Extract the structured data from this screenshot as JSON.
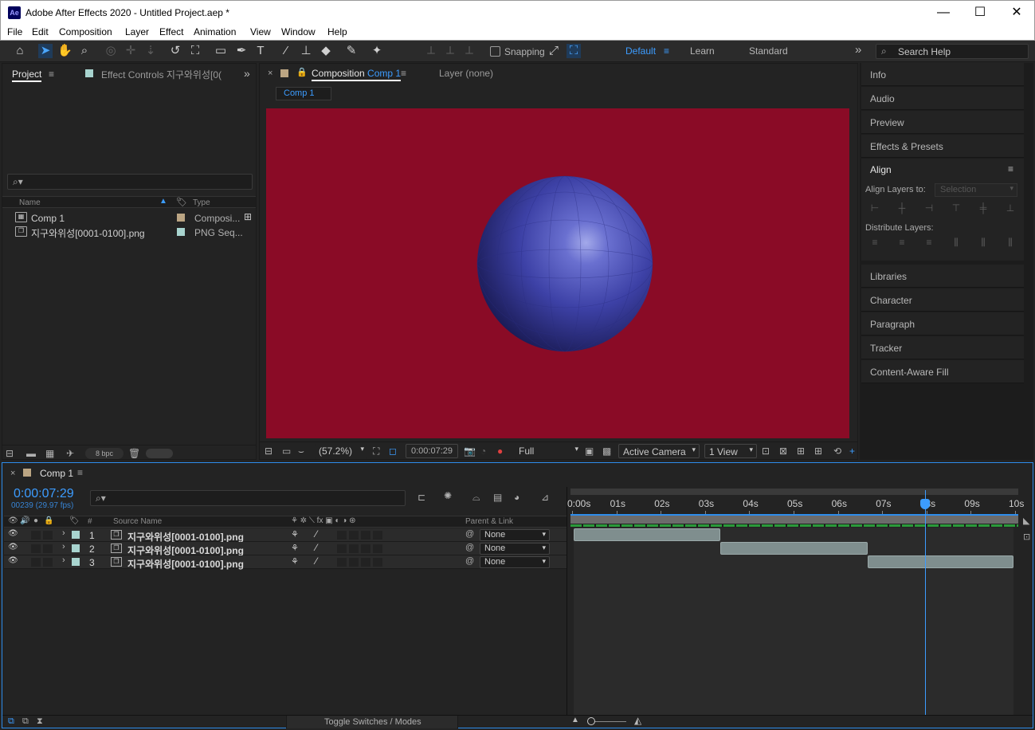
{
  "app": {
    "logo": "Ae",
    "title": "Adobe After Effects 2020 - Untitled Project.aep *",
    "minimize": "—",
    "maximize": "☐",
    "close": "✕"
  },
  "menu": [
    "File",
    "Edit",
    "Composition",
    "Layer",
    "Effect",
    "Animation",
    "View",
    "Window",
    "Help"
  ],
  "toolbar": {
    "snapping": "Snapping",
    "workspaces": [
      "Default",
      "Learn",
      "Standard"
    ],
    "search_placeholder": "Search Help",
    "more": "»"
  },
  "project": {
    "tab_project": "Project",
    "tab_effect_controls": "Effect Controls 지구와위성[0(",
    "search_icon": "⌕▾",
    "columns": {
      "name": "Name",
      "type": "Type"
    },
    "items": [
      {
        "name": "Comp 1",
        "type": "Composi...",
        "color": "#bba583"
      },
      {
        "name": "지구와위성[0001-0100].png",
        "type": "PNG Seq...",
        "color": "#a8d4cf"
      }
    ],
    "bpc": "8 bpc"
  },
  "composition": {
    "tab": "Composition",
    "tab_comp": "Comp 1",
    "tab_layer": "Layer (none)",
    "breadcrumb": "Comp 1",
    "bg_color": "#8a0b26",
    "zoom": "(57.2%)",
    "timecode": "0:00:07:29",
    "resolution": "Full",
    "camera": "Active Camera",
    "views": "1 View"
  },
  "right_panel": {
    "items": [
      "Info",
      "Audio",
      "Preview",
      "Effects & Presets"
    ],
    "align_title": "Align",
    "align_to_label": "Align Layers to:",
    "align_to_value": "Selection",
    "distribute_label": "Distribute Layers:",
    "items2": [
      "Libraries",
      "Character",
      "Paragraph",
      "Tracker",
      "Content-Aware Fill"
    ]
  },
  "timeline": {
    "tab": "Comp 1",
    "timecode": "0:00:07:29",
    "frames": "00239 (29.97 fps)",
    "search_icon": "⌕▾",
    "col_hash": "#",
    "col_source": "Source Name",
    "col_parent": "Parent & Link",
    "layers": [
      {
        "num": "1",
        "name": "지구와위성[0001-0100].png",
        "parent": "None",
        "start": 0,
        "end": 3.34
      },
      {
        "num": "2",
        "name": "지구와위성[0001-0100].png",
        "parent": "None",
        "start": 3.34,
        "end": 6.67
      },
      {
        "num": "3",
        "name": "지구와위성[0001-0100].png",
        "parent": "None",
        "start": 6.67,
        "end": 10
      }
    ],
    "ruler": [
      "0:00s",
      "01s",
      "02s",
      "03s",
      "04s",
      "05s",
      "06s",
      "07s",
      "08s",
      "09s",
      "10s"
    ],
    "playhead_seconds": 7.97,
    "duration_seconds": 10,
    "toggle": "Toggle Switches / Modes"
  }
}
